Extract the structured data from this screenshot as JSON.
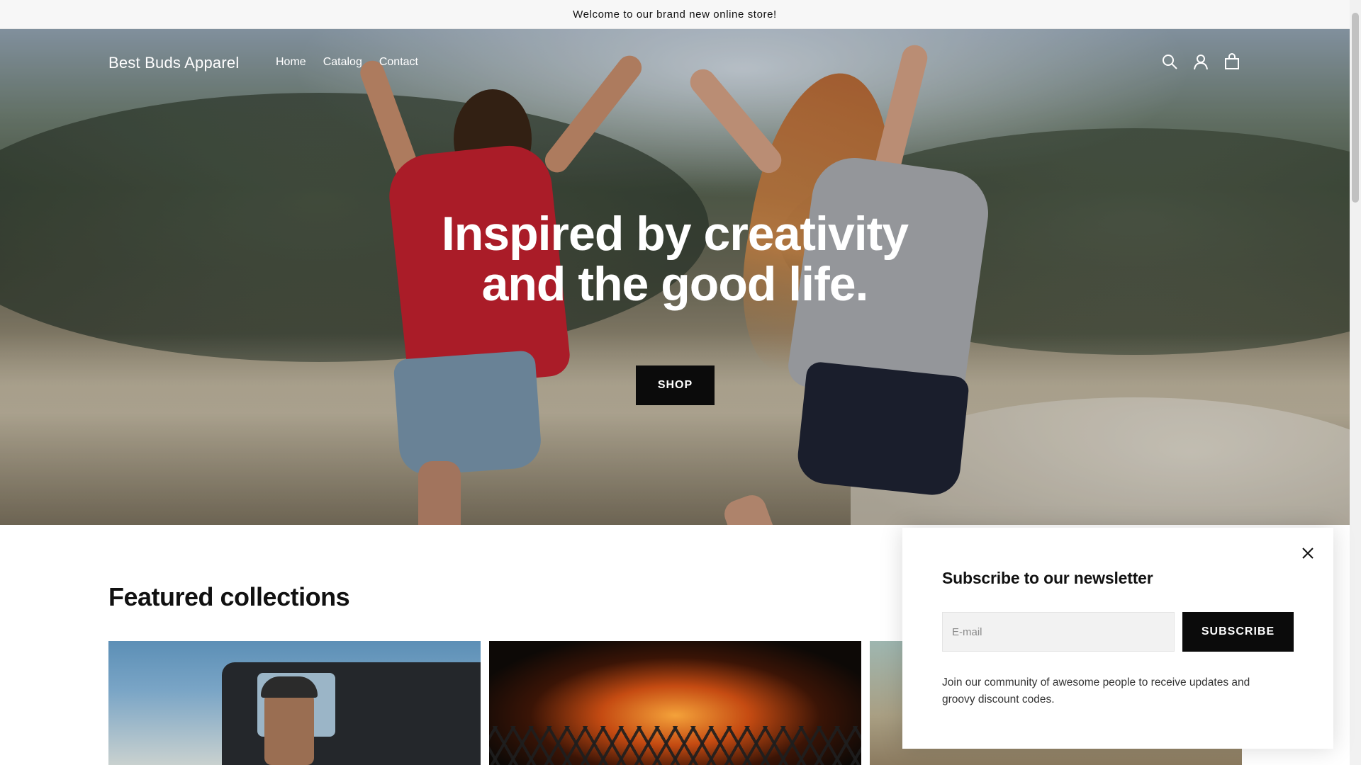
{
  "announcement": {
    "text": "Welcome to our brand new online store!"
  },
  "header": {
    "logo": "Best Buds Apparel",
    "nav": [
      "Home",
      "Catalog",
      "Contact"
    ],
    "icons": [
      "search-icon",
      "account-icon",
      "cart-icon"
    ]
  },
  "hero": {
    "title_line1": "Inspired by creativity",
    "title_line2": "and the good life.",
    "button_label": "SHOP"
  },
  "featured": {
    "title": "Featured collections"
  },
  "newsletter": {
    "title": "Subscribe to our newsletter",
    "email_placeholder": "E-mail",
    "email_value": "",
    "button_label": "SUBSCRIBE",
    "description": "Join our community of awesome people to receive updates and groovy discount codes."
  },
  "colors": {
    "button_bg": "#0b0b0b",
    "text": "#111111",
    "announcement_bg": "#f7f7f7"
  }
}
